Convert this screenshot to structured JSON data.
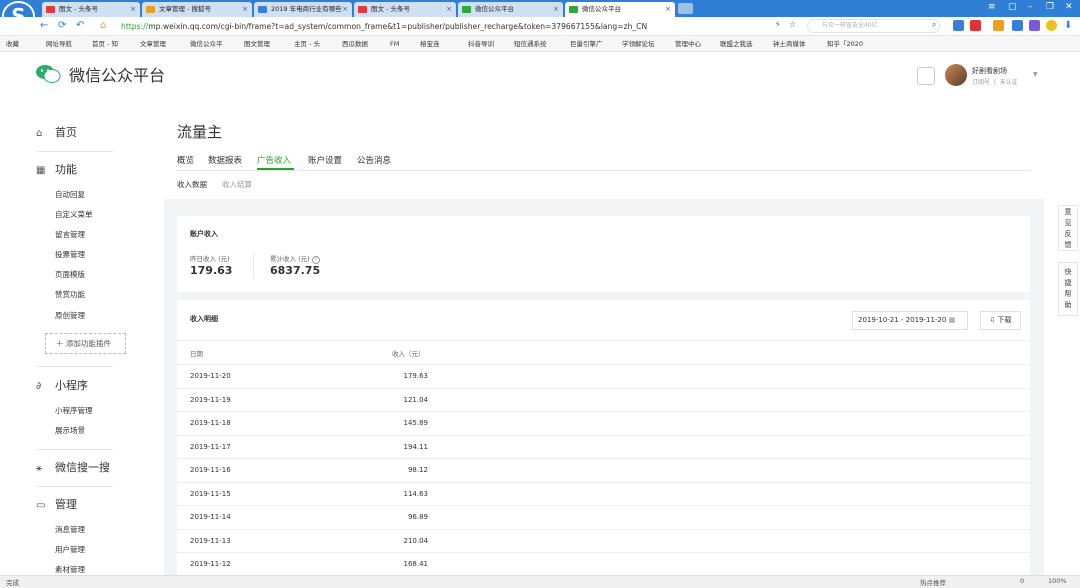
{
  "browser": {
    "tabs": [
      {
        "label": "图文 - 头条号",
        "fav": "#e23a3a",
        "active": false
      },
      {
        "label": "文章管理 - 搜狐号",
        "fav": "#e8a020",
        "active": false
      },
      {
        "label": "2019 年电商行业有哪些",
        "fav": "#3a7ed6",
        "active": false
      },
      {
        "label": "图文 - 头条号",
        "fav": "#e23a3a",
        "active": false
      },
      {
        "label": "微信公众平台",
        "fav": "#2aaa3a",
        "active": false
      },
      {
        "label": "微信公众平台",
        "fav": "#2aaa3a",
        "active": true
      }
    ],
    "url_prefix": "https://",
    "url": "mp.weixin.qq.com/cgi-bin/frame?t=ad_system/common_frame&t1=publisher/publisher_recharge&token=379667155&lang=zh_CN",
    "search_placeholder": "与众一样宣告全40亿",
    "bookmarks": [
      "收藏",
      "网址导航",
      "首页 - 知",
      "文章管理",
      "微信公众平",
      "图文管理",
      "主页 - 头",
      "西瓜数据",
      "FM",
      "榕宝连",
      "抖音导训",
      "短信通系统",
      "巨量引擎广",
      "学领解论坛",
      "管理中心",
      "联盟之我选",
      "钟土商媒体",
      "知乎「2020"
    ],
    "status_left": "完成",
    "status_right": [
      "热点推荐",
      "0",
      "100%"
    ]
  },
  "header": {
    "site_title": "微信公众平台",
    "user_name": "好剧看剧场",
    "user_type": "订阅号",
    "user_status": "未认证"
  },
  "sidebar": {
    "sections": [
      {
        "icon": "home-icon",
        "label": "首页",
        "items": []
      },
      {
        "icon": "grid-icon",
        "label": "功能",
        "items": [
          "自动回复",
          "自定义菜单",
          "留言管理",
          "投票管理",
          "页面模版",
          "赞赏功能",
          "原创管理"
        ]
      },
      {
        "icon": "mini-program-icon",
        "label": "小程序",
        "items": [
          "小程序管理",
          "展示场景"
        ]
      },
      {
        "icon": "search-icon",
        "label": "微信搜一搜",
        "items": []
      },
      {
        "icon": "monitor-icon",
        "label": "管理",
        "items": [
          "消息管理",
          "用户管理",
          "素材管理"
        ]
      }
    ],
    "add_plugin": "添加功能插件"
  },
  "main": {
    "title": "流量主",
    "tabs": [
      "概览",
      "数据报表",
      "广告收入",
      "账户设置",
      "公告消息"
    ],
    "subtabs": [
      "收入数据",
      "收入结算"
    ],
    "account": {
      "title": "账户收入",
      "yesterday_label": "昨日收入 (元)",
      "yesterday_value": "179.63",
      "total_label": "累计收入 (元)",
      "total_value": "6837.75"
    },
    "detail": {
      "title": "收入明细",
      "date_range": "2019-10-21 - 2019-11-20",
      "download": "下载",
      "col_date": "日期",
      "col_income": "收入（元）",
      "rows": [
        {
          "date": "2019-11-20",
          "income": "179.63"
        },
        {
          "date": "2019-11-19",
          "income": "121.04"
        },
        {
          "date": "2019-11-18",
          "income": "145.89"
        },
        {
          "date": "2019-11-17",
          "income": "194.11"
        },
        {
          "date": "2019-11-16",
          "income": "98.12"
        },
        {
          "date": "2019-11-15",
          "income": "114.63"
        },
        {
          "date": "2019-11-14",
          "income": "96.89"
        },
        {
          "date": "2019-11-13",
          "income": "210.04"
        },
        {
          "date": "2019-11-12",
          "income": "168.41"
        }
      ]
    }
  },
  "float": {
    "feedback": "意见反馈",
    "help": "快捷帮助"
  },
  "colors": {
    "accent": "#1aad19",
    "browser": "#2f7fd6"
  }
}
